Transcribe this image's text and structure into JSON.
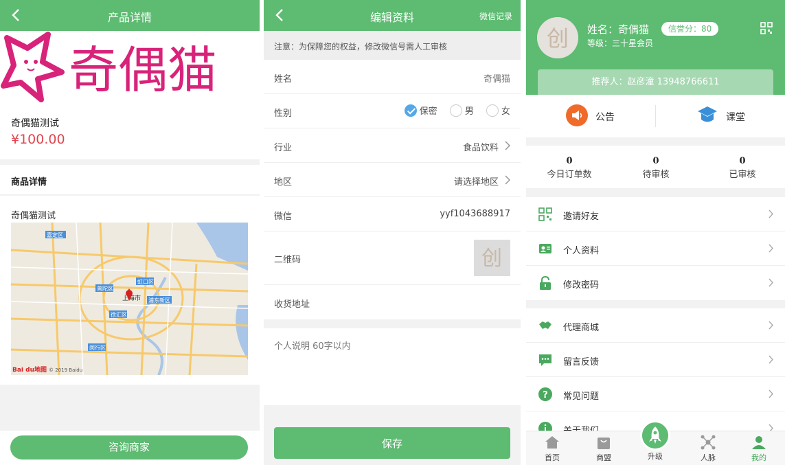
{
  "product_page": {
    "header_title": "产品详情",
    "banner_text": "奇偶猫",
    "product_name": "奇偶猫测试",
    "price": "¥100.00",
    "detail_section_title": "商品详情",
    "detail_text": "奇偶猫测试",
    "map_labels": {
      "jiading": "嘉定区",
      "hongkou": "虹口区",
      "putuo": "普陀区",
      "pudong": "浦东新区",
      "xuhui": "徐汇区",
      "minhang": "闵行区",
      "city": "上海市",
      "watermark": "© 2019 Baidu",
      "logo": "Bai du地图"
    },
    "consult_button": "咨询商家"
  },
  "edit_page": {
    "header_title": "编辑资料",
    "header_link": "微信记录",
    "notice": "注意：为保障您的权益，修改微信号需人工审核",
    "fields": {
      "name_label": "姓名",
      "name_value": "奇偶猫",
      "gender_label": "性别",
      "gender_options": [
        "保密",
        "男",
        "女"
      ],
      "gender_selected": "保密",
      "industry_label": "行业",
      "industry_value": "食品饮料",
      "region_label": "地区",
      "region_value": "请选择地区",
      "wechat_label": "微信",
      "wechat_value": "yyf1043688917",
      "qrcode_label": "二维码",
      "address_label": "收货地址"
    },
    "bio_placeholder": "个人说明 60字以内",
    "save_button": "保存"
  },
  "profile_page": {
    "avatar_char": "创",
    "name": "姓名：奇偶猫",
    "credit_badge": "信誉分：80",
    "level": "等级：三十星会员",
    "referrer": "推荐人：赵彦潼  13948766611",
    "quick_links": [
      "公告",
      "课堂"
    ],
    "stats": [
      {
        "value": "0",
        "label": "今日订单数"
      },
      {
        "value": "0",
        "label": "待审核"
      },
      {
        "value": "0",
        "label": "已审核"
      }
    ],
    "menu_group_1": [
      "邀请好友",
      "个人资料",
      "修改密码"
    ],
    "menu_group_2": [
      "代理商城",
      "留言反馈",
      "常见问题",
      "关于我们"
    ],
    "tabs": [
      "首页",
      "商盟",
      "升级",
      "人脉",
      "我的"
    ],
    "active_tab": "我的",
    "colors": {
      "primary_green": "#5dbb72",
      "price_red": "#e0454e",
      "radio_blue": "#55a8e8",
      "notice_orange": "#f06a2a",
      "classroom_blue": "#3a8fd8"
    }
  }
}
